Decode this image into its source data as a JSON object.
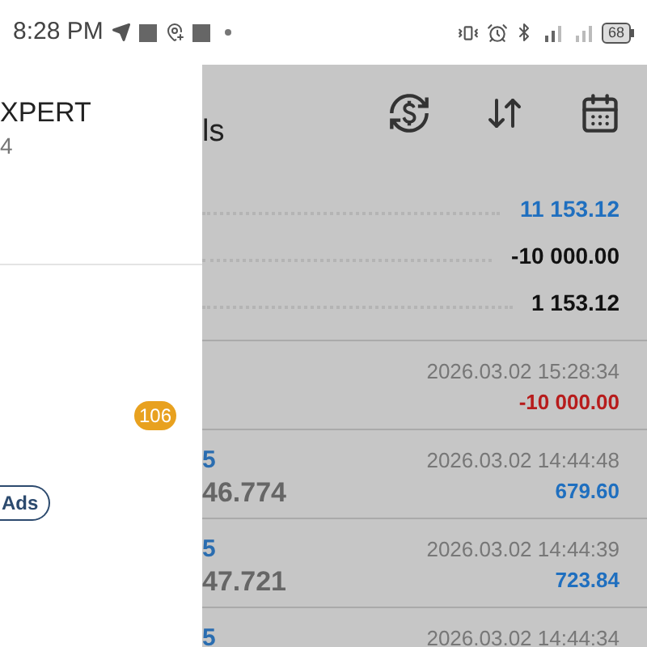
{
  "status_bar": {
    "time": "8:28 PM",
    "battery": "68"
  },
  "drawer": {
    "title": "XPERT",
    "subtitle": "4",
    "badge": "106",
    "ads_button": "Ads"
  },
  "panel": {
    "title": "ls",
    "summary": [
      {
        "value": "11 153.12",
        "color": "#1f6fbf"
      },
      {
        "value": "-10 000.00",
        "color": "#111111"
      },
      {
        "value": "1 153.12",
        "color": "#111111"
      }
    ],
    "deals": [
      {
        "time": "2026.03.02 15:28:34",
        "amount": "-10 000.00",
        "color": "#b71c1c"
      },
      {
        "column_1": "5",
        "column_2": "46.774",
        "time": "2026.03.02 14:44:48",
        "amount": "679.60",
        "color": "#1f6fbf"
      },
      {
        "column_1": "5",
        "column_2": "47.721",
        "time": "2026.03.02 14:44:39",
        "amount": "723.84",
        "color": "#1f6fbf"
      },
      {
        "column_1": "5",
        "time": "2026.03.02 14:44:34"
      }
    ]
  }
}
